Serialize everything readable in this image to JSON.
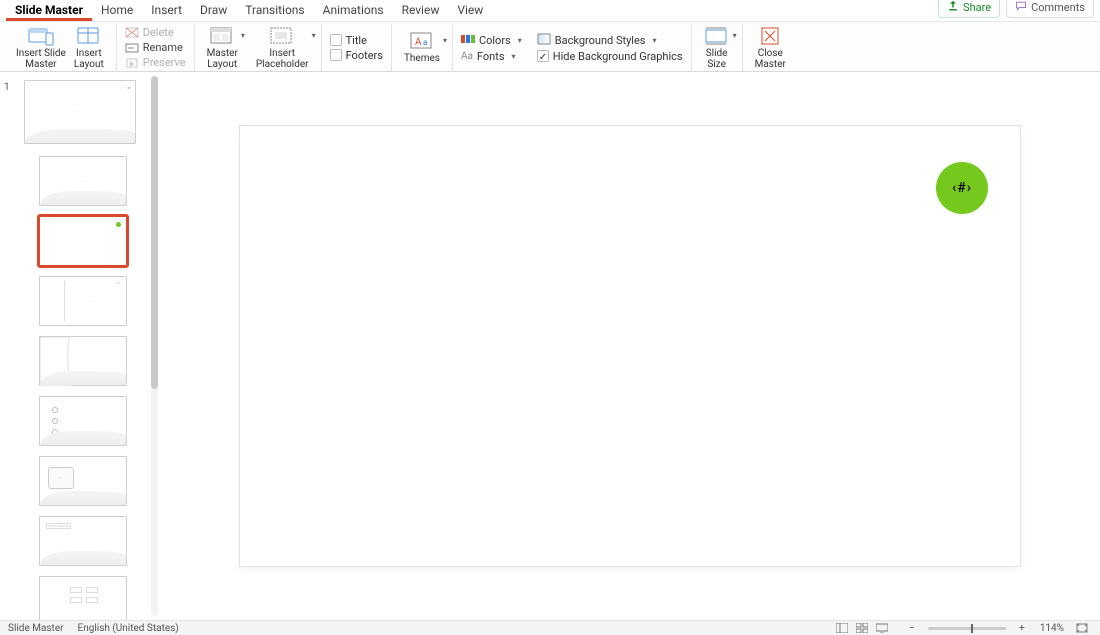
{
  "tabs": {
    "items": [
      "Slide Master",
      "Home",
      "Insert",
      "Draw",
      "Transitions",
      "Animations",
      "Review",
      "View"
    ],
    "active_index": 0
  },
  "top_right": {
    "share": "Share",
    "comments": "Comments"
  },
  "ribbon": {
    "insert_slide_master": "Insert Slide\nMaster",
    "insert_layout": "Insert\nLayout",
    "delete": "Delete",
    "rename": "Rename",
    "preserve": "Preserve",
    "master_layout": "Master\nLayout",
    "insert_placeholder": "Insert\nPlaceholder",
    "title": "Title",
    "footers": "Footers",
    "themes": "Themes",
    "colors": "Colors",
    "fonts": "Fonts",
    "background_styles": "Background Styles",
    "hide_bg": "Hide Background Graphics",
    "slide_size": "Slide\nSize",
    "close_master": "Close\nMaster"
  },
  "thumbs": {
    "master_number": "1",
    "selected_index": 1
  },
  "slide": {
    "circle_text": "‹#›"
  },
  "status": {
    "mode": "Slide Master",
    "lang": "English (United States)",
    "zoom": "114%"
  }
}
